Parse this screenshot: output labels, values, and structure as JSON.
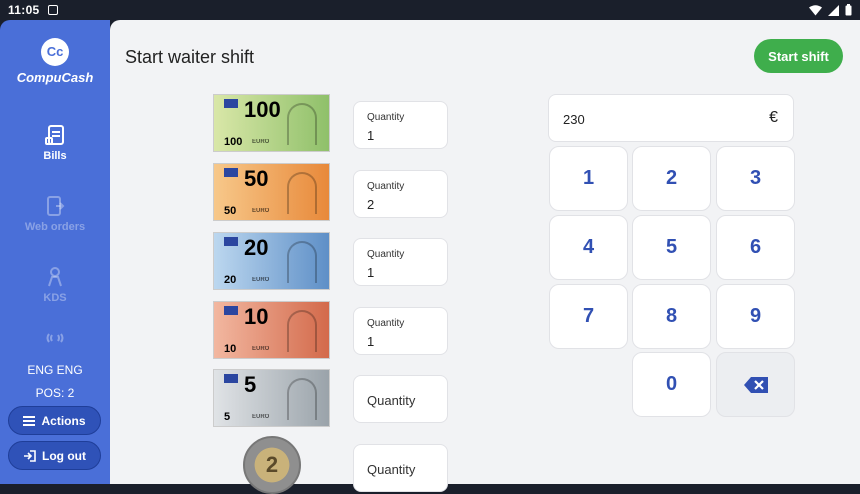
{
  "statusbar": {
    "time": "11:05"
  },
  "sidebar": {
    "logo_mark": "Cc",
    "logo_text": "CompuCash",
    "nav": [
      {
        "label": "Bills",
        "icon": "bills-icon",
        "enabled": true
      },
      {
        "label": "Web orders",
        "icon": "web-orders-icon",
        "enabled": false
      },
      {
        "label": "KDS",
        "icon": "kds-icon",
        "enabled": false
      }
    ],
    "language": "ENG ENG",
    "pos": "POS: 2",
    "actions_label": "Actions",
    "logout_label": "Log out"
  },
  "header": {
    "title": "Start waiter shift",
    "start_button": "Start shift"
  },
  "denominations": [
    {
      "value": "100",
      "color_from": "#d9e7a8",
      "color_to": "#8fc06a",
      "quantity_label": "Quantity",
      "quantity": "1"
    },
    {
      "value": "50",
      "color_from": "#f7c88a",
      "color_to": "#e8893a",
      "quantity_label": "Quantity",
      "quantity": "2"
    },
    {
      "value": "20",
      "color_from": "#bcd7ef",
      "color_to": "#5e8fc7",
      "quantity_label": "Quantity",
      "quantity": "1"
    },
    {
      "value": "10",
      "color_from": "#f2b7a0",
      "color_to": "#d36a4b",
      "quantity_label": "Quantity",
      "quantity": "1"
    },
    {
      "value": "5",
      "color_from": "#e0e3e6",
      "color_to": "#9aa3aa",
      "quantity_label": "",
      "quantity": "",
      "placeholder": "Quantity"
    },
    {
      "value": "2",
      "coin": true,
      "quantity_label": "",
      "quantity": "",
      "placeholder": "Quantity"
    }
  ],
  "keypad": {
    "display_value": "230",
    "currency": "€",
    "keys": [
      "1",
      "2",
      "3",
      "4",
      "5",
      "6",
      "7",
      "8",
      "9",
      "0"
    ]
  }
}
